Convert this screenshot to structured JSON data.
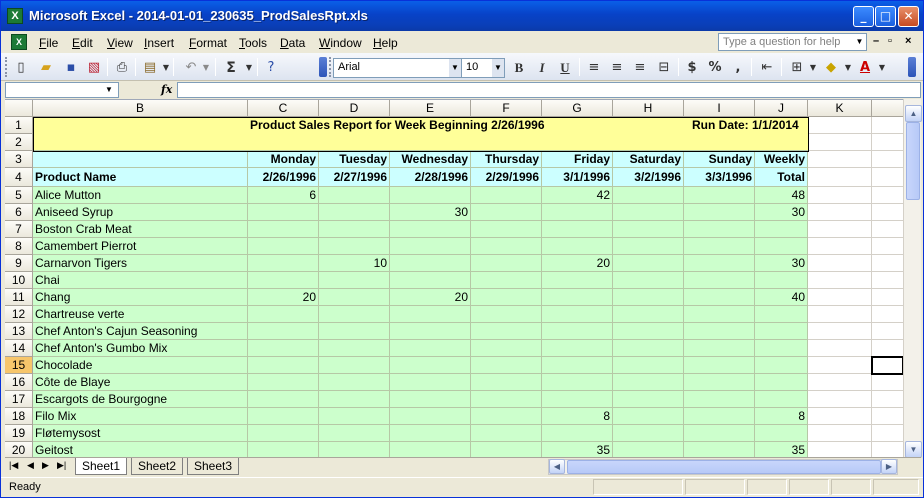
{
  "window": {
    "title": "Microsoft Excel - 2014-01-01_230635_ProdSalesRpt.xls",
    "minimize": "_",
    "maximize": "□",
    "close": "✕"
  },
  "menu": {
    "items": [
      "File",
      "Edit",
      "View",
      "Insert",
      "Format",
      "Tools",
      "Data",
      "Window",
      "Help"
    ],
    "ask_placeholder": "Type a question for help"
  },
  "toolbar": {
    "font_name": "Arial",
    "font_size": "10",
    "icons": [
      "new-icon",
      "open-icon",
      "save-icon",
      "permission-icon",
      "print-icon",
      "paste-icon",
      "undo-icon",
      "autosum-icon",
      "help-icon",
      "bold-icon",
      "italic-icon",
      "underline-icon",
      "align-left-icon",
      "align-center-icon",
      "align-right-icon",
      "merge-center-icon",
      "currency-icon",
      "percent-icon",
      "comma-icon",
      "decrease-indent-icon",
      "borders-icon",
      "fill-color-icon",
      "font-color-icon"
    ],
    "bold": "B",
    "italic": "I",
    "underline": "U",
    "autosum": "Σ",
    "currency": "$",
    "percent": "%",
    "comma": ",",
    "font_color": "A"
  },
  "formula_bar": {
    "fx": "fx",
    "name_box": "",
    "formula": ""
  },
  "sheet": {
    "columns": [
      "B",
      "C",
      "D",
      "E",
      "F",
      "G",
      "H",
      "I",
      "J",
      "K"
    ],
    "row_numbers": [
      "1",
      "2",
      "3",
      "4",
      "5",
      "6",
      "7",
      "8",
      "9",
      "10",
      "11",
      "12",
      "13",
      "14",
      "15",
      "16",
      "17",
      "18",
      "19",
      "20"
    ],
    "selected_row": "15",
    "report_title": "Product Sales Report for Week Beginning 2/26/1996",
    "run_date": "Run Date: 1/1/2014",
    "header_days": [
      "",
      "Monday",
      "Tuesday",
      "Wednesday",
      "Thursday",
      "Friday",
      "Saturday",
      "Sunday",
      "Weekly"
    ],
    "header_dates": [
      "Product Name",
      "2/26/1996",
      "2/27/1996",
      "2/28/1996",
      "2/29/1996",
      "3/1/1996",
      "3/2/1996",
      "3/3/1996",
      "Total"
    ],
    "rows": [
      [
        "Alice Mutton",
        "6",
        "",
        "",
        "",
        "42",
        "",
        "",
        "48"
      ],
      [
        "Aniseed Syrup",
        "",
        "",
        "30",
        "",
        "",
        "",
        "",
        "30"
      ],
      [
        "Boston Crab Meat",
        "",
        "",
        "",
        "",
        "",
        "",
        "",
        ""
      ],
      [
        "Camembert Pierrot",
        "",
        "",
        "",
        "",
        "",
        "",
        "",
        ""
      ],
      [
        "Carnarvon Tigers",
        "",
        "10",
        "",
        "",
        "20",
        "",
        "",
        "30"
      ],
      [
        "Chai",
        "",
        "",
        "",
        "",
        "",
        "",
        "",
        ""
      ],
      [
        "Chang",
        "20",
        "",
        "20",
        "",
        "",
        "",
        "",
        "40"
      ],
      [
        "Chartreuse verte",
        "",
        "",
        "",
        "",
        "",
        "",
        "",
        ""
      ],
      [
        "Chef Anton's Cajun Seasoning",
        "",
        "",
        "",
        "",
        "",
        "",
        "",
        ""
      ],
      [
        "Chef Anton's Gumbo Mix",
        "",
        "",
        "",
        "",
        "",
        "",
        "",
        ""
      ],
      [
        "Chocolade",
        "",
        "",
        "",
        "",
        "",
        "",
        "",
        ""
      ],
      [
        "Côte de Blaye",
        "",
        "",
        "",
        "",
        "",
        "",
        "",
        ""
      ],
      [
        "Escargots de Bourgogne",
        "",
        "",
        "",
        "",
        "",
        "",
        "",
        ""
      ],
      [
        "Filo Mix",
        "",
        "",
        "",
        "",
        "8",
        "",
        "",
        "8"
      ],
      [
        "Fløtemysost",
        "",
        "",
        "",
        "",
        "",
        "",
        "",
        ""
      ],
      [
        "Geitost",
        "",
        "",
        "",
        "",
        "35",
        "",
        "",
        "35"
      ]
    ]
  },
  "tabs": [
    "Sheet1",
    "Sheet2",
    "Sheet3"
  ],
  "status": "Ready",
  "colors": {
    "green": "#ccffcc",
    "yellow": "#ffff99",
    "cyan": "#ccffff",
    "title_blue": "#0842c7"
  }
}
